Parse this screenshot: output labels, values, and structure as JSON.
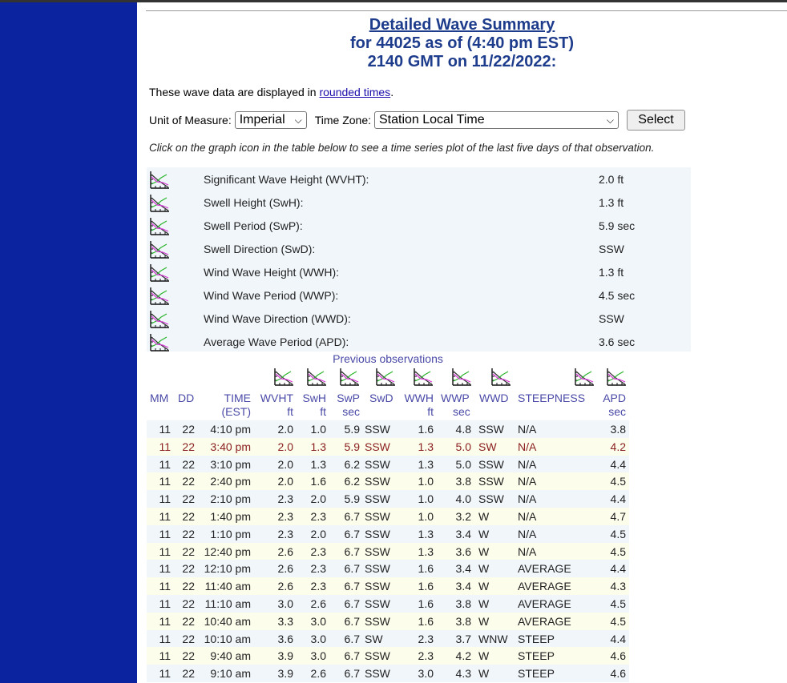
{
  "header": {
    "title": "Detailed Wave Summary",
    "line2": "for 44025 as of (4:40 pm EST)",
    "line3": "2140 GMT on 11/22/2022:"
  },
  "info": {
    "prefix": "These wave data are displayed in ",
    "link": "rounded times",
    "suffix": "."
  },
  "controls": {
    "unit_label": "Unit of Measure:",
    "unit_value": "Imperial",
    "tz_label": "Time Zone:",
    "tz_value": "Station Local Time",
    "select_button": "Select"
  },
  "note": "Click on the graph icon in the table below to see a time series plot of the last five days of that observation.",
  "summary": [
    {
      "label": "Significant Wave Height (WVHT):",
      "value": "2.0 ft"
    },
    {
      "label": "Swell Height (SwH):",
      "value": "1.3 ft"
    },
    {
      "label": "Swell Period (SwP):",
      "value": "5.9 sec"
    },
    {
      "label": "Swell Direction (SwD):",
      "value": "SSW"
    },
    {
      "label": "Wind Wave Height (WWH):",
      "value": "1.3 ft"
    },
    {
      "label": "Wind Wave Period (WWP):",
      "value": "4.5 sec"
    },
    {
      "label": "Wind Wave Direction (WWD):",
      "value": "SSW"
    },
    {
      "label": "Average Wave Period (APD):",
      "value": "3.6 sec"
    }
  ],
  "previous": {
    "title": "Previous observations",
    "columns": {
      "mm": "MM",
      "dd": "DD",
      "time": "TIME",
      "time_unit": "(EST)",
      "wvht": "WVHT",
      "wvht_unit": "ft",
      "swh": "SwH",
      "swh_unit": "ft",
      "swp": "SwP",
      "swp_unit": "sec",
      "swd": "SwD",
      "wwh": "WWH",
      "wwh_unit": "ft",
      "wwp": "WWP",
      "wwp_unit": "sec",
      "wwd": "WWD",
      "steepness": "STEEPNESS",
      "apd": "APD",
      "apd_unit": "sec"
    },
    "rows": [
      [
        "11",
        "22",
        "4:10 pm",
        "2.0",
        "1.0",
        "5.9",
        "SSW",
        "1.6",
        "4.8",
        "SSW",
        "N/A",
        "3.8"
      ],
      [
        "11",
        "22",
        "3:40 pm",
        "2.0",
        "1.3",
        "5.9",
        "SSW",
        "1.3",
        "5.0",
        "SW",
        "N/A",
        "4.2"
      ],
      [
        "11",
        "22",
        "3:10 pm",
        "2.0",
        "1.3",
        "6.2",
        "SSW",
        "1.3",
        "5.0",
        "SSW",
        "N/A",
        "4.4"
      ],
      [
        "11",
        "22",
        "2:40 pm",
        "2.0",
        "1.6",
        "6.2",
        "SSW",
        "1.0",
        "3.8",
        "SSW",
        "N/A",
        "4.5"
      ],
      [
        "11",
        "22",
        "2:10 pm",
        "2.3",
        "2.0",
        "5.9",
        "SSW",
        "1.0",
        "4.0",
        "SSW",
        "N/A",
        "4.4"
      ],
      [
        "11",
        "22",
        "1:40 pm",
        "2.3",
        "2.3",
        "6.7",
        "SSW",
        "1.0",
        "3.2",
        "W",
        "N/A",
        "4.7"
      ],
      [
        "11",
        "22",
        "1:10 pm",
        "2.3",
        "2.0",
        "6.7",
        "SSW",
        "1.3",
        "3.4",
        "W",
        "N/A",
        "4.5"
      ],
      [
        "11",
        "22",
        "12:40 pm",
        "2.6",
        "2.3",
        "6.7",
        "SSW",
        "1.3",
        "3.6",
        "W",
        "N/A",
        "4.5"
      ],
      [
        "11",
        "22",
        "12:10 pm",
        "2.6",
        "2.3",
        "6.7",
        "SSW",
        "1.6",
        "3.4",
        "W",
        "AVERAGE",
        "4.4"
      ],
      [
        "11",
        "22",
        "11:40 am",
        "2.6",
        "2.3",
        "6.7",
        "SSW",
        "1.6",
        "3.4",
        "W",
        "AVERAGE",
        "4.3"
      ],
      [
        "11",
        "22",
        "11:10 am",
        "3.0",
        "2.6",
        "6.7",
        "SSW",
        "1.6",
        "3.8",
        "W",
        "AVERAGE",
        "4.5"
      ],
      [
        "11",
        "22",
        "10:40 am",
        "3.3",
        "3.0",
        "6.7",
        "SSW",
        "1.6",
        "3.8",
        "W",
        "AVERAGE",
        "4.5"
      ],
      [
        "11",
        "22",
        "10:10 am",
        "3.6",
        "3.0",
        "6.7",
        "SW",
        "2.3",
        "3.7",
        "WNW",
        "STEEP",
        "4.4"
      ],
      [
        "11",
        "22",
        "9:40 am",
        "3.9",
        "3.0",
        "6.7",
        "SSW",
        "2.3",
        "4.2",
        "W",
        "STEEP",
        "4.6"
      ],
      [
        "11",
        "22",
        "9:10 am",
        "3.9",
        "2.6",
        "6.7",
        "SSW",
        "3.0",
        "4.3",
        "W",
        "STEEP",
        "4.6"
      ]
    ]
  },
  "colors": {
    "sidebar": "#0b239e",
    "title": "#1e3c8c",
    "highlight_row_text": "#8b2020",
    "header_text": "#4a4aa8"
  },
  "icons": {
    "graph": "graph-plot-icon",
    "dropdown": "chevron-down-icon"
  }
}
